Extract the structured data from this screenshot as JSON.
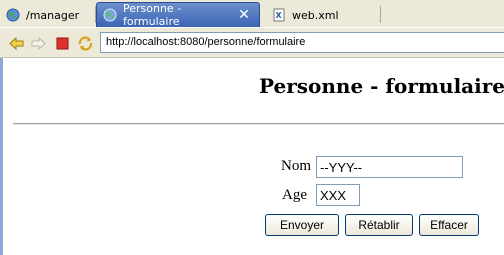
{
  "tabs": [
    {
      "label": "/manager",
      "icon": "globe-icon",
      "active": false
    },
    {
      "label": "Personne - formulaire",
      "icon": "globe-icon",
      "active": true,
      "close_label": "✕"
    },
    {
      "label": "web.xml",
      "icon": "xml-file-icon",
      "active": false
    }
  ],
  "toolbar": {
    "buttons": [
      "back-arrow-icon",
      "forward-arrow-icon",
      "stop-icon",
      "refresh-icon"
    ],
    "url": "http://localhost:8080/personne/formulaire"
  },
  "page": {
    "title": "Personne - formulaire",
    "form": {
      "nom_label": "Nom",
      "nom_value": "--YYY--",
      "age_label": "Age",
      "age_value": "XXX",
      "submit_label": "Envoyer",
      "reset_label": "Rétablir",
      "clear_label": "Effacer"
    }
  },
  "colors": {
    "active_tab": "#3b64b4",
    "chrome": "#ece9d8",
    "input_border": "#7f9db9"
  }
}
